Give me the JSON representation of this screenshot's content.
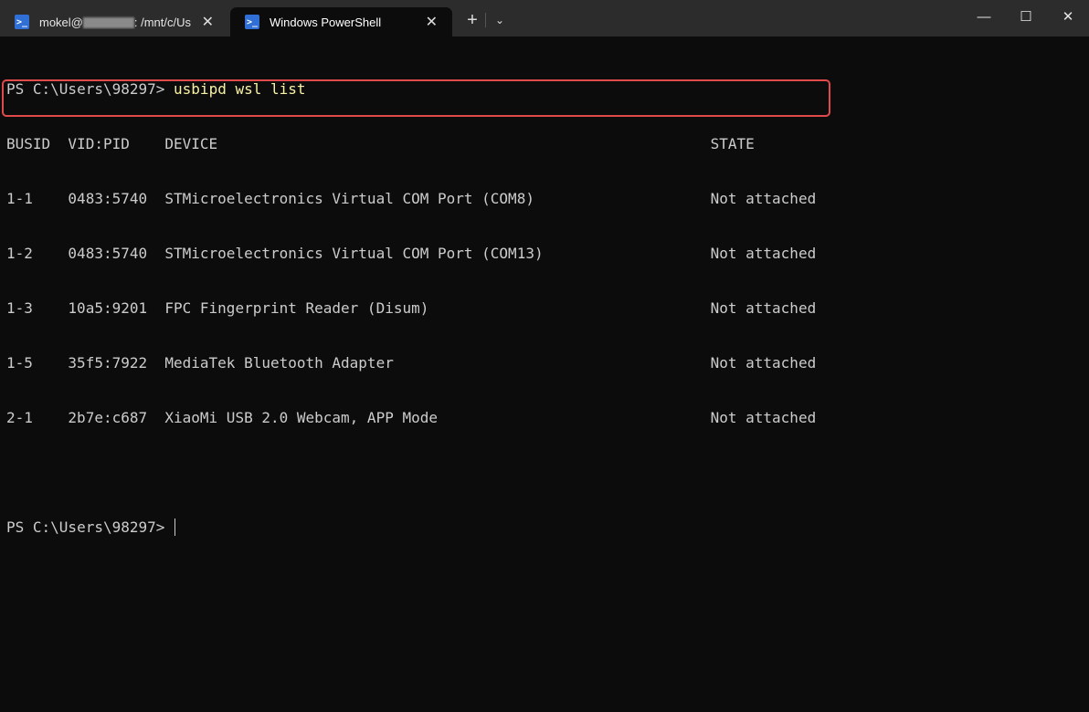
{
  "window": {
    "tabs": [
      {
        "label_prefix": "mokel@",
        "label_suffix": ": /mnt/c/Us",
        "icon": "powershell-icon",
        "active": false
      },
      {
        "label": "Windows PowerShell",
        "icon": "powershell-icon",
        "active": true
      }
    ],
    "new_tab": "+",
    "dropdown": "⌄",
    "controls": {
      "minimize": "—",
      "maximize": "☐",
      "close": "✕"
    },
    "tab_close": "✕"
  },
  "terminal": {
    "prompt": "PS C:\\Users\\98297> ",
    "command": "usbipd wsl list",
    "headers": {
      "busid": "BUSID",
      "vidpid": "VID:PID",
      "device": "DEVICE",
      "state": "STATE"
    },
    "rows": [
      {
        "busid": "1-1",
        "vidpid": "0483:5740",
        "device": "STMicroelectronics Virtual COM Port (COM8)",
        "state": "Not attached"
      },
      {
        "busid": "1-2",
        "vidpid": "0483:5740",
        "device": "STMicroelectronics Virtual COM Port (COM13)",
        "state": "Not attached"
      },
      {
        "busid": "1-3",
        "vidpid": "10a5:9201",
        "device": "FPC Fingerprint Reader (Disum)",
        "state": "Not attached"
      },
      {
        "busid": "1-5",
        "vidpid": "35f5:7922",
        "device": "MediaTek Bluetooth Adapter",
        "state": "Not attached"
      },
      {
        "busid": "2-1",
        "vidpid": "2b7e:c687",
        "device": "XiaoMi USB 2.0 Webcam, APP Mode",
        "state": "Not attached"
      }
    ],
    "prompt2": "PS C:\\Users\\98297> "
  },
  "colors": {
    "background": "#0c0c0c",
    "text": "#cccccc",
    "command": "#f9f1a5",
    "highlight_box": "#e04a4a"
  }
}
